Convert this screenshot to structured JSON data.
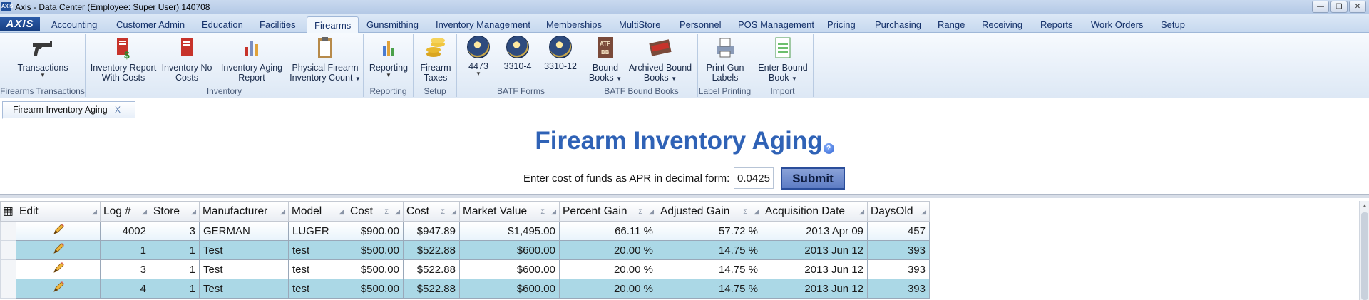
{
  "window": {
    "app_icon_text": "AXIS",
    "title": "Axis - Data Center  (Employee: Super User) 140708"
  },
  "ribbon": {
    "logo": "AXIS",
    "tabs": [
      "Accounting",
      "Customer Admin",
      "Education",
      "Facilities",
      "Firearms",
      "Gunsmithing",
      "Inventory Management",
      "Memberships",
      "MultiStore",
      "Personnel",
      "POS Management",
      "Pricing",
      "Purchasing",
      "Range",
      "Receiving",
      "Reports",
      "Work Orders",
      "Setup"
    ],
    "active_tab": "Firearms",
    "groups": {
      "transactions": "Firearms Transactions",
      "inventory": "Inventory",
      "reporting": "Reporting",
      "setup": "Setup",
      "batf_forms": "BATF Forms",
      "bound_books": "BATF Bound Books",
      "label_printing": "Label Printing",
      "import": "Import"
    },
    "buttons": {
      "transactions": "Transactions",
      "inv_report_costs_1": "Inventory Report",
      "inv_report_costs_2": "With Costs",
      "inv_no_costs_1": "Inventory No",
      "inv_no_costs_2": "Costs",
      "inv_aging_1": "Inventory Aging",
      "inv_aging_2": "Report",
      "physical_count_1": "Physical Firearm",
      "physical_count_2": "Inventory Count",
      "reporting": "Reporting",
      "firearm_taxes_1": "Firearm",
      "firearm_taxes_2": "Taxes",
      "form_4473": "4473",
      "form_3310_4": "3310-4",
      "form_3310_12": "3310-12",
      "bound_books_1": "Bound",
      "bound_books_2": "Books",
      "archived_books_1": "Archived Bound",
      "archived_books_2": "Books",
      "print_labels_1": "Print Gun",
      "print_labels_2": "Labels",
      "enter_bound_1": "Enter Bound",
      "enter_bound_2": "Book"
    }
  },
  "doc_tab": {
    "label": "Firearm Inventory Aging",
    "close": "X"
  },
  "report": {
    "title": "Firearm Inventory Aging",
    "help": "?",
    "apr_label": "Enter cost of funds as APR in decimal form:",
    "apr_value": "0.0425",
    "submit": "Submit"
  },
  "grid": {
    "columns": [
      "Edit",
      "Log #",
      "Store",
      "Manufacturer",
      "Model",
      "Cost",
      "Cost",
      "Market Value",
      "Percent Gain",
      "Adjusted Gain",
      "Acquisition Date",
      "DaysOld"
    ],
    "rows": [
      [
        "",
        "4002",
        "3",
        "GERMAN",
        "LUGER",
        "$900.00",
        "$947.89",
        "$1,495.00",
        "66.11 %",
        "57.72 %",
        "2013 Apr 09",
        "457"
      ],
      [
        "",
        "1",
        "1",
        "Test",
        "test",
        "$500.00",
        "$522.88",
        "$600.00",
        "20.00 %",
        "14.75 %",
        "2013 Jun 12",
        "393"
      ],
      [
        "",
        "3",
        "1",
        "Test",
        "test",
        "$500.00",
        "$522.88",
        "$600.00",
        "20.00 %",
        "14.75 %",
        "2013 Jun 12",
        "393"
      ],
      [
        "",
        "4",
        "1",
        "Test",
        "test",
        "$500.00",
        "$522.88",
        "$600.00",
        "20.00 %",
        "14.75 %",
        "2013 Jun 12",
        "393"
      ]
    ]
  }
}
